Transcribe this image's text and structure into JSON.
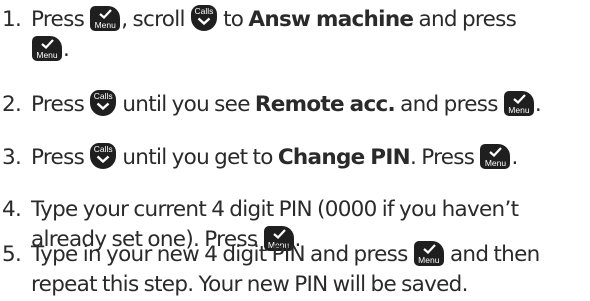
{
  "icons": {
    "menu_key": "menu-key-icon",
    "calls_key": "calls-down-key-icon",
    "menu_key_label": "Menu",
    "calls_key_label": "Calls",
    "key_color": "#1f1f1f",
    "key_text_color": "#ffffff"
  },
  "steps": [
    {
      "number": "1.",
      "t1": "Press",
      "t2": ", scroll",
      "t3": "to",
      "bold1": "Answ machine",
      "t4": "and press",
      "t5": "."
    },
    {
      "number": "2.",
      "t1": "Press",
      "t2": "until you see",
      "bold1": "Remote acc.",
      "t3": "and press",
      "t4": "."
    },
    {
      "number": "3.",
      "t1": "Press",
      "t2": "until you get to",
      "bold1": "Change PIN",
      "t3": ". Press",
      "t4": "."
    },
    {
      "number": "4.",
      "t1": "Type your current 4 digit PIN (0000 if you haven’t",
      "t2": "already set one). Press",
      "t3": "."
    },
    {
      "number": "5.",
      "t1": "Type in your new 4 digit PIN and press",
      "t2": "and then",
      "t3": "repeat this step. Your new PIN will be saved."
    }
  ]
}
